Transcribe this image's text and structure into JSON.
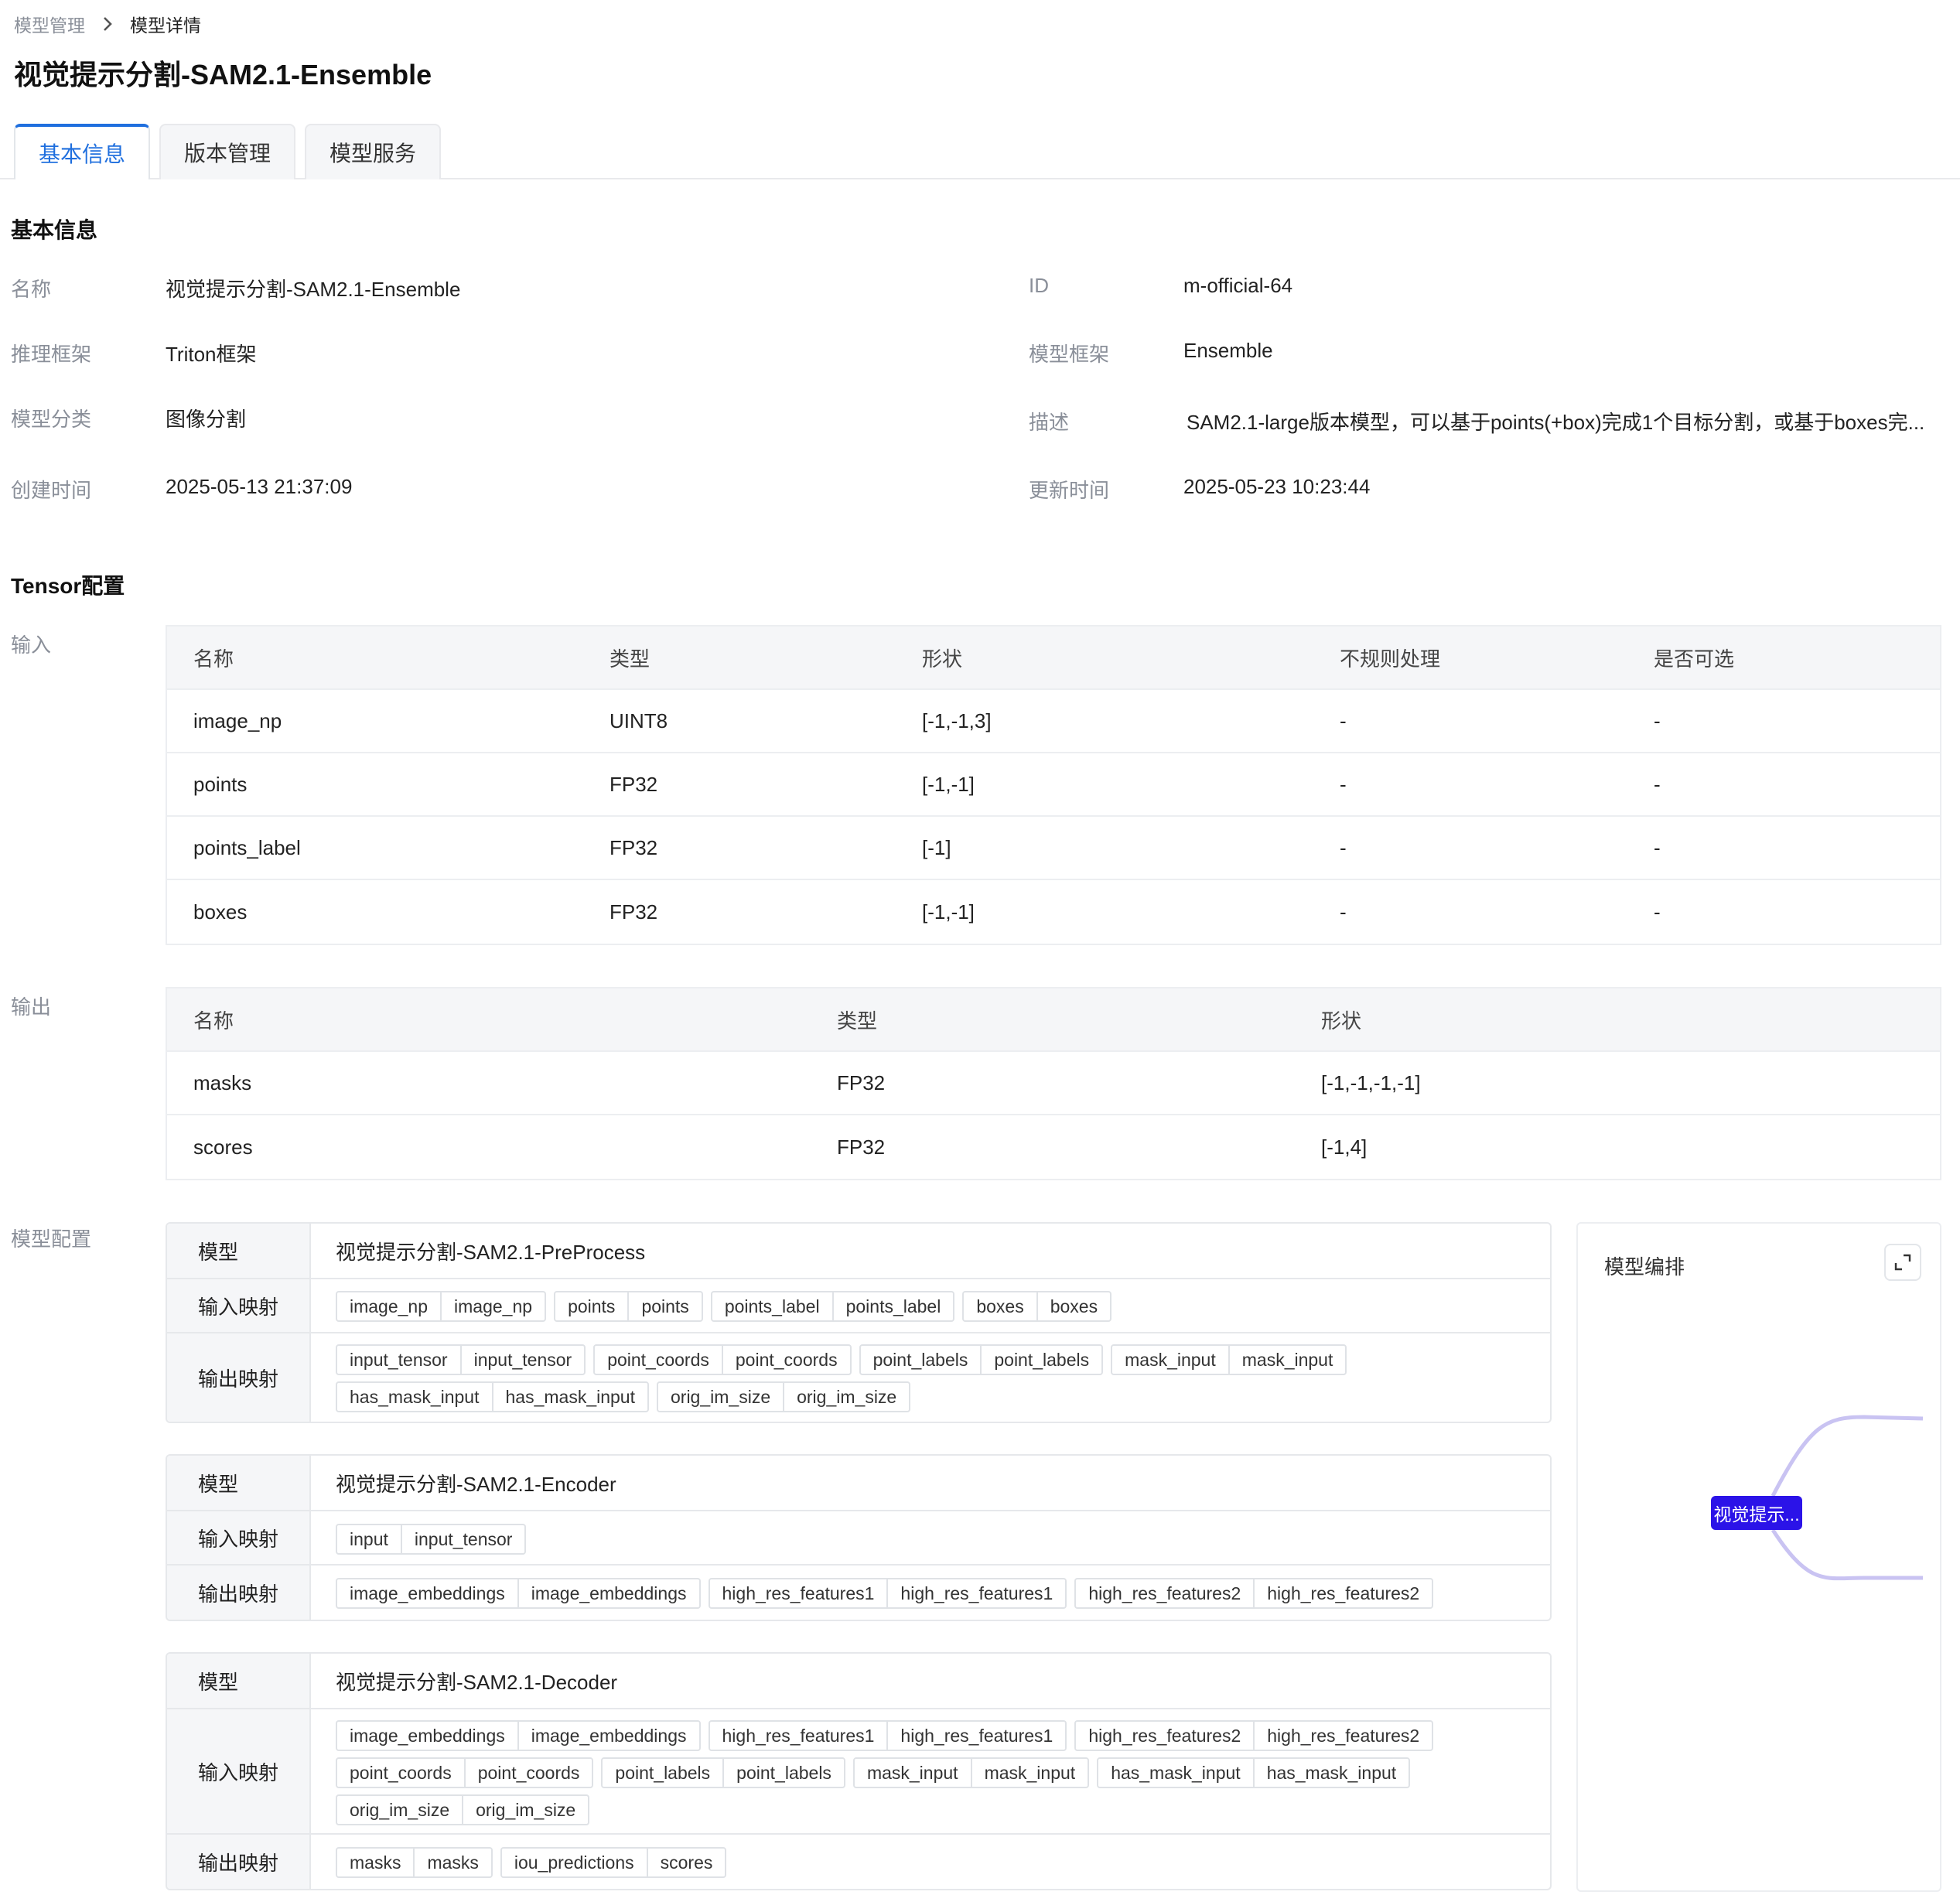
{
  "breadcrumb": {
    "parent": "模型管理",
    "current": "模型详情"
  },
  "title": "视觉提示分割-SAM2.1-Ensemble",
  "tabs": [
    "基本信息",
    "版本管理",
    "模型服务"
  ],
  "basic": {
    "section_title": "基本信息",
    "left": [
      {
        "label": "名称",
        "value": "视觉提示分割-SAM2.1-Ensemble"
      },
      {
        "label": "推理框架",
        "value": "Triton框架"
      },
      {
        "label": "模型分类",
        "value": "图像分割"
      },
      {
        "label": "创建时间",
        "value": "2025-05-13 21:37:09"
      }
    ],
    "right": [
      {
        "label": "ID",
        "value": "m-official-64"
      },
      {
        "label": "模型框架",
        "value": "Ensemble"
      },
      {
        "label": "描述",
        "value": "SAM2.1-large版本模型，可以基于points(+box)完成1个目标分割，或基于boxes完..."
      },
      {
        "label": "更新时间",
        "value": "2025-05-23 10:23:44"
      }
    ]
  },
  "tensor": {
    "section_title": "Tensor配置",
    "input_label": "输入",
    "output_label": "输出",
    "input_headers": [
      "名称",
      "类型",
      "形状",
      "不规则处理",
      "是否可选"
    ],
    "input_rows": [
      [
        "image_np",
        "UINT8",
        "[-1,-1,3]",
        "-",
        "-"
      ],
      [
        "points",
        "FP32",
        "[-1,-1]",
        "-",
        "-"
      ],
      [
        "points_label",
        "FP32",
        "[-1]",
        "-",
        "-"
      ],
      [
        "boxes",
        "FP32",
        "[-1,-1]",
        "-",
        "-"
      ]
    ],
    "output_headers": [
      "名称",
      "类型",
      "形状"
    ],
    "output_rows": [
      [
        "masks",
        "FP32",
        "[-1,-1,-1,-1]"
      ],
      [
        "scores",
        "FP32",
        "[-1,4]"
      ]
    ]
  },
  "model_config": {
    "label": "模型配置",
    "key_model": "模型",
    "key_input": "输入映射",
    "key_output": "输出映射",
    "blocks": [
      {
        "model": "视觉提示分割-SAM2.1-PreProcess",
        "inputs": [
          [
            "image_np",
            "image_np"
          ],
          [
            "points",
            "points"
          ],
          [
            "points_label",
            "points_label"
          ],
          [
            "boxes",
            "boxes"
          ]
        ],
        "outputs": [
          [
            "input_tensor",
            "input_tensor"
          ],
          [
            "point_coords",
            "point_coords"
          ],
          [
            "point_labels",
            "point_labels"
          ],
          [
            "mask_input",
            "mask_input"
          ],
          [
            "has_mask_input",
            "has_mask_input"
          ],
          [
            "orig_im_size",
            "orig_im_size"
          ]
        ]
      },
      {
        "model": "视觉提示分割-SAM2.1-Encoder",
        "inputs": [
          [
            "input",
            "input_tensor"
          ]
        ],
        "outputs": [
          [
            "image_embeddings",
            "image_embeddings"
          ],
          [
            "high_res_features1",
            "high_res_features1"
          ],
          [
            "high_res_features2",
            "high_res_features2"
          ]
        ]
      },
      {
        "model": "视觉提示分割-SAM2.1-Decoder",
        "inputs": [
          [
            "image_embeddings",
            "image_embeddings"
          ],
          [
            "high_res_features1",
            "high_res_features1"
          ],
          [
            "high_res_features2",
            "high_res_features2"
          ],
          [
            "point_coords",
            "point_coords"
          ],
          [
            "point_labels",
            "point_labels"
          ],
          [
            "mask_input",
            "mask_input"
          ],
          [
            "has_mask_input",
            "has_mask_input"
          ],
          [
            "orig_im_size",
            "orig_im_size"
          ]
        ],
        "outputs": [
          [
            "masks",
            "masks"
          ],
          [
            "iou_predictions",
            "scores"
          ]
        ]
      }
    ]
  },
  "orchestration": {
    "title": "模型编排",
    "node_label": "视觉提示..."
  },
  "colors": {
    "accent": "#1f6fde",
    "node": "#2b13e8",
    "edge": "#c9c3f2"
  },
  "icons": {
    "breadcrumb_separator": "chevron-right-icon",
    "expand": "expand-icon"
  }
}
